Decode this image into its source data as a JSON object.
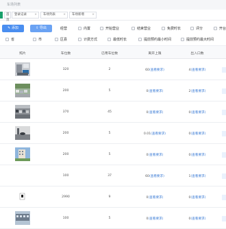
{
  "topbar": {
    "title": "车场列表"
  },
  "tabs": [
    {
      "label": ""
    },
    {
      "label": "首页"
    },
    {
      "label": "登录记录"
    },
    {
      "label": "车场列表"
    },
    {
      "label": "车场新增"
    }
  ],
  "toolbar": {
    "add_label": "添加",
    "export_label": "导出"
  },
  "filters_row1": [
    "经营",
    "内置",
    "开始营业",
    "结束营业",
    "免费时长",
    "评分",
    "开台"
  ],
  "filters_row2": [
    "省",
    "市",
    "区县",
    "计费方式",
    "最低时长",
    "提前预约最小时间",
    "提前预约最大时间"
  ],
  "table": {
    "headers": [
      "照片",
      "车位数",
      "已用车位数",
      "离开上限",
      "出入口数"
    ],
    "link_text": "(查看要求)",
    "rows": [
      {
        "spaces": "320",
        "used": "2",
        "limit_num": "60",
        "gates_num": "4",
        "photo": "scene-a"
      },
      {
        "spaces": "200",
        "used": "5",
        "limit_num": "0",
        "gates_num": "2",
        "photo": "scene-b"
      },
      {
        "spaces": "370",
        "used": "45",
        "limit_num": "0",
        "gates_num": "0",
        "photo": "scene-c"
      },
      {
        "spaces": "200",
        "used": "5",
        "limit_num": "0.01",
        "gates_num": "0",
        "photo": "scene-d"
      },
      {
        "spaces": "200",
        "used": "5",
        "limit_num": "0",
        "gates_num": "0",
        "photo": "scene-e"
      },
      {
        "spaces": "100",
        "used": "37",
        "limit_num": "60",
        "gates_num": "1",
        "photo": "none"
      },
      {
        "spaces": "2990",
        "used": "9",
        "limit_num": "0",
        "gates_num": "0",
        "photo": "scene-f"
      },
      {
        "spaces": "100",
        "used": "5",
        "limit_num": "0",
        "gates_num": "0",
        "photo": "scene-g"
      }
    ]
  },
  "colors": {
    "accent": "#4a8ef0",
    "tab_active": "#1aa06b",
    "link": "#3a7bd5"
  }
}
